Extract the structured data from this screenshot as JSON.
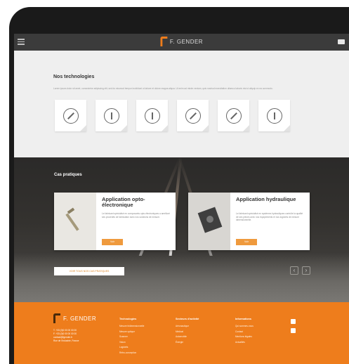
{
  "header": {
    "logo_text": "F. GENDER"
  },
  "technologies": {
    "title": "Nos technologies",
    "description": "Lorem ipsum dolor sit amet, consectetur adipiscing elit, sed do eiusmod tempor incididunt ut labore et dolore magna aliqua. Ut enim ad minim veniam, quis nostrud exercitation ullamco laboris nisi ut aliquip ex ea commodo.",
    "cards": [
      {
        "icon": "technology-1-icon"
      },
      {
        "icon": "technology-2-icon"
      },
      {
        "icon": "technology-3-icon"
      },
      {
        "icon": "technology-4-icon"
      },
      {
        "icon": "technology-5-icon"
      },
      {
        "icon": "technology-6-icon"
      }
    ]
  },
  "practice": {
    "title": "Cas pratiques",
    "cases": [
      {
        "title": "Application opto-électronique",
        "text": "Le fabricant spécialisé en composants opto-électroniques a amélioré ses procédés de fabrication avec nos solutions de mesure.",
        "button": "Voir"
      },
      {
        "title": "Application hydraulique",
        "text": "Le fabricant spécialisé en systèmes hydrauliques contrôle la qualité de ses pièces avec nos équipements et nos logiciels de mesure dimensionnelle.",
        "button": "Voir"
      }
    ],
    "all_button": "VOIR TOUS NOS CAS PRATIQUES",
    "prev": "‹",
    "next": "›"
  },
  "footer": {
    "logo_text": "F. GENDER",
    "contact_lines": [
      "T. +33 (0)0 00 00 00 00",
      "F. +33 (0)0 00 00 00 00",
      "contact@fgender.fr",
      "Rue de l'Industrie, France"
    ],
    "columns": [
      {
        "title": "Technologies",
        "items": [
          "Mesure tridimensionnelle",
          "Mesure optique",
          "Scanner",
          "Vision",
          "Logiciels",
          "Rétro-conception"
        ]
      },
      {
        "title": "Secteurs d'activité",
        "items": [
          "Aéronautique",
          "Médical",
          "Automobile",
          "Énergie"
        ]
      },
      {
        "title": "Informations",
        "items": [
          "Qui sommes-nous",
          "Contact",
          "Mentions légales",
          "Actualités"
        ]
      }
    ],
    "social_icons": [
      "social-icon-1",
      "social-icon-2"
    ]
  },
  "colors": {
    "accent": "#ee7d1c",
    "topbar": "#3b3b3b",
    "device": "#1a1a1a"
  }
}
